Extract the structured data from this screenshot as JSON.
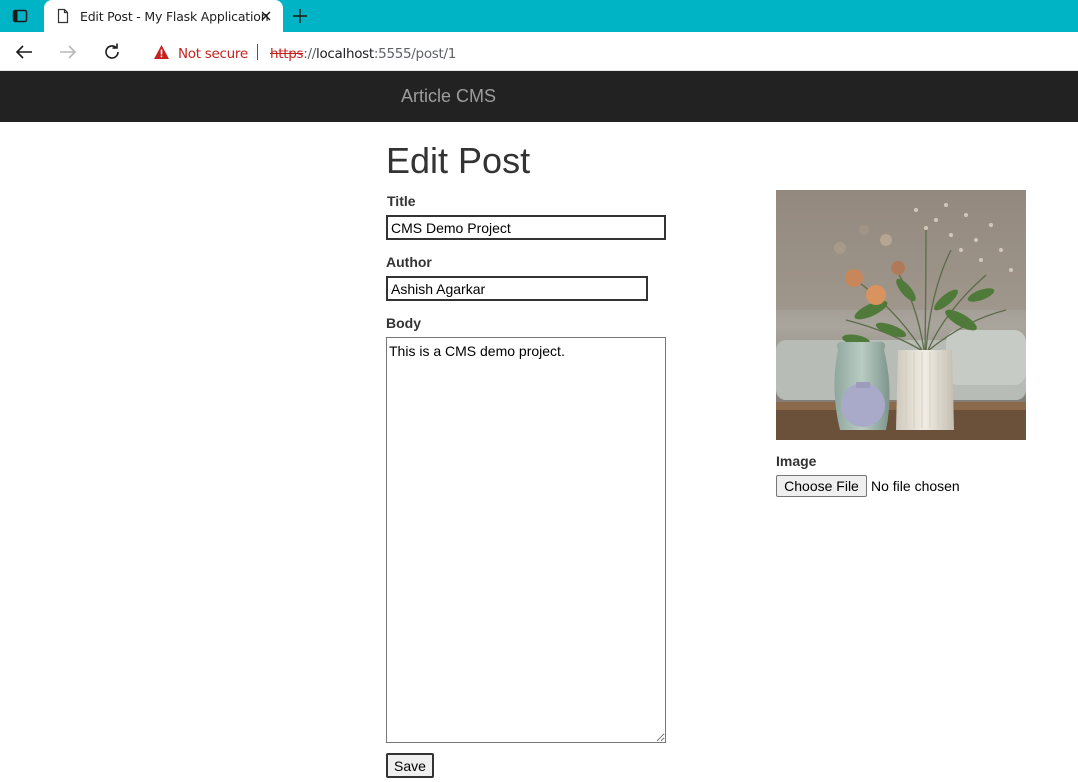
{
  "browser": {
    "tab_title": "Edit Post - My Flask Application",
    "security_label": "Not secure",
    "url_scheme": "https",
    "url_sep": "://",
    "url_host": "localhost",
    "url_rest": ":5555/post/1"
  },
  "navbar": {
    "brand": "Article CMS"
  },
  "form": {
    "heading": "Edit Post",
    "title_label": "Title",
    "title_value": "CMS Demo Project",
    "author_label": "Author",
    "author_value": "Ashish Agarkar",
    "body_label": "Body",
    "body_value": "This is a CMS demo project.",
    "save_label": "Save",
    "image_label": "Image",
    "choose_file_label": "Choose File",
    "no_file_text": "No file chosen"
  },
  "icons": {
    "window": "window-icon",
    "page": "page-icon",
    "close": "close-icon",
    "new_tab": "plus-icon",
    "back": "back-arrow-icon",
    "forward": "forward-arrow-icon",
    "reload": "reload-icon",
    "warning": "warning-icon"
  }
}
